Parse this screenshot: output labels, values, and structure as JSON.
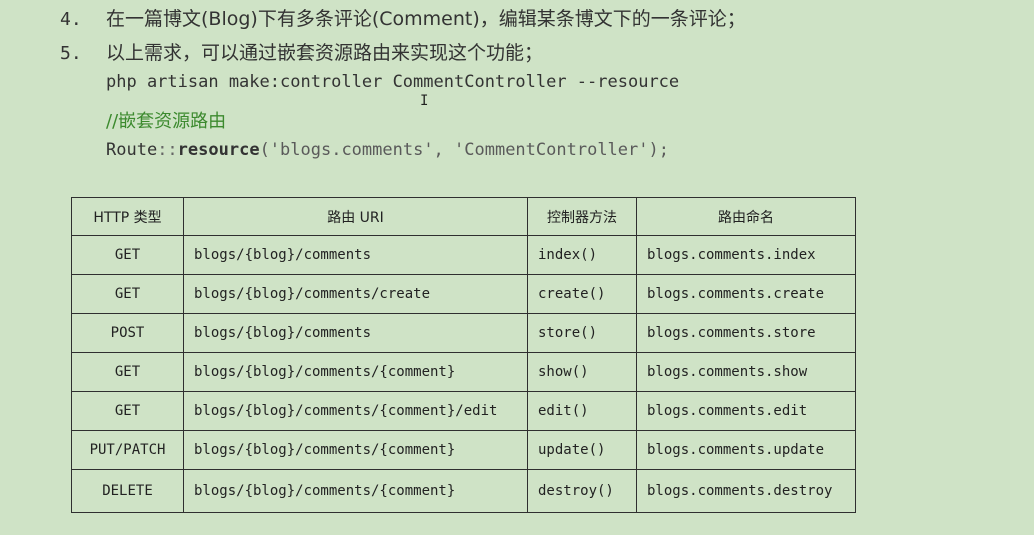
{
  "list": {
    "item4": {
      "number": "4.",
      "text": "在一篇博文(Blog)下有多条评论(Comment)，编辑某条博文下的一条评论；"
    },
    "item5": {
      "number": "5.",
      "text": "以上需求，可以通过嵌套资源路由来实现这个功能；"
    }
  },
  "code": {
    "command": "php artisan make:controller CommentController --resource",
    "comment": "//嵌套资源路由",
    "route_class": "Route",
    "route_sep": "::",
    "route_method": "resource",
    "route_args": "('blogs.comments', 'CommentController');"
  },
  "table": {
    "headers": [
      "HTTP 类型",
      "路由 URI",
      "控制器方法",
      "路由命名"
    ],
    "rows": [
      [
        "GET",
        "blogs/{blog}/comments",
        "index()",
        "blogs.comments.index"
      ],
      [
        "GET",
        "blogs/{blog}/comments/create",
        "create()",
        "blogs.comments.create"
      ],
      [
        "POST",
        "blogs/{blog}/comments",
        "store()",
        "blogs.comments.store"
      ],
      [
        "GET",
        "blogs/{blog}/comments/{comment}",
        "show()",
        "blogs.comments.show"
      ],
      [
        "GET",
        "blogs/{blog}/comments/{comment}/edit",
        "edit()",
        "blogs.comments.edit"
      ],
      [
        "PUT/PATCH",
        "blogs/{blog}/comments/{comment}",
        "update()",
        "blogs.comments.update"
      ],
      [
        "DELETE",
        "blogs/{blog}/comments/{comment}",
        "destroy()",
        "blogs.comments.destroy"
      ]
    ]
  }
}
